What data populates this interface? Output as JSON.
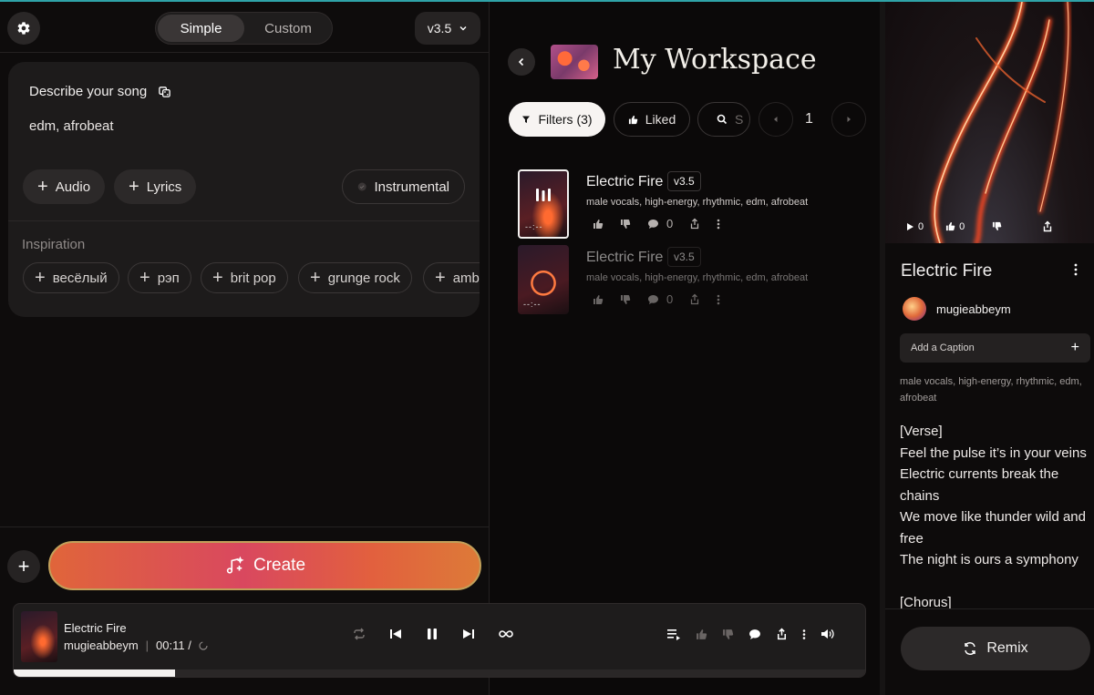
{
  "left": {
    "mode_tabs": [
      "Simple",
      "Custom"
    ],
    "version": "v3.5",
    "describe_label": "Describe your song",
    "prompt_value": "edm, afrobeat",
    "audio_label": "Audio",
    "lyrics_label": "Lyrics",
    "instrumental_label": "Instrumental",
    "inspiration_label": "Inspiration",
    "inspiration_chips": [
      "весёлый",
      "рэп",
      "brit pop",
      "grunge rock",
      "amb"
    ],
    "create_label": "Create"
  },
  "workspace": {
    "title": "My Workspace",
    "filters_label": "Filters (3)",
    "liked_label": "Liked",
    "search_placeholder": "S",
    "page_number": "1",
    "songs": [
      {
        "title": "Electric Fire",
        "version": "v3.5",
        "tags": "male vocals, high-energy, rhythmic, edm, afrobeat",
        "comments": "0",
        "time": "--:--"
      },
      {
        "title": "Electric Fire",
        "version": "v3.5",
        "tags": "male vocals, high-energy, rhythmic, edm, afrobeat",
        "comments": "0",
        "time": "--:--"
      }
    ]
  },
  "detail": {
    "play_count": "0",
    "like_count": "0",
    "title": "Electric Fire",
    "user": "mugieabbeym",
    "caption_placeholder": "Add a Caption",
    "tags": "male vocals, high-energy, rhythmic, edm, afrobeat",
    "lyrics": "[Verse]\nFeel the pulse it’s in your veins\nElectric currents break the chains\nWe move like thunder wild and free\nThe night is ours a symphony\n\n[Chorus]",
    "remix_label": "Remix"
  },
  "player": {
    "title": "Electric Fire",
    "user": "mugieabbeym",
    "separator": "|",
    "time": "00:11 /",
    "progress": 0.19
  },
  "colors": {
    "accent_top_line": "#2fa3a8",
    "create_gradient_start": "#e0653a",
    "create_gradient_mid": "#d9485f"
  }
}
